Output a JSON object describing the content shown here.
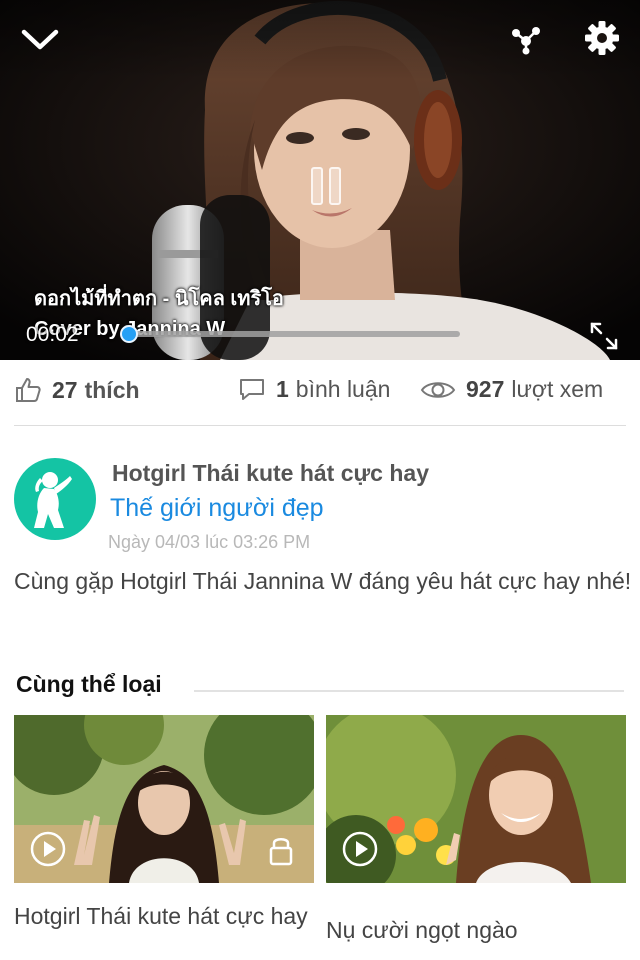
{
  "player": {
    "caption_line1": "ดอกไม้ที่ทำตก - นิโคล เทริโอ",
    "caption_line2": "Cover by Jannina W",
    "current_time": "00:02",
    "progress_fraction": 0.01,
    "state": "playing"
  },
  "icons": {
    "back": "chevron-down-icon",
    "share": "share-icon",
    "settings": "gear-icon",
    "pause": "pause-icon",
    "fullscreen": "fullscreen-icon",
    "like": "thumbs-up-icon",
    "comment": "comment-icon",
    "view": "eye-icon",
    "play": "play-icon",
    "lock": "lock-icon"
  },
  "stats": {
    "likes_count": "27",
    "likes_label": "thích",
    "comments_count": "1",
    "comments_label": "bình luận",
    "views_count": "927",
    "views_label": "lượt xem"
  },
  "post": {
    "title": "Hotgirl Thái kute hát cực hay",
    "channel": "Thế giới người đẹp",
    "date": "Ngày 04/03 lúc 03:26 PM",
    "description": "Cùng gặp Hotgirl Thái Jannina W đáng yêu hát cực hay nhé!"
  },
  "related": {
    "section_title": "Cùng thể loại",
    "items": [
      {
        "title": "Hotgirl Thái kute hát cực hay",
        "locked": true
      },
      {
        "title": "Nụ cười ngọt ngào",
        "locked": false
      }
    ]
  },
  "colors": {
    "accent": "#1a8ae0",
    "avatar_bg": "#14c4a4",
    "seek_fill": "#1e90e8"
  }
}
